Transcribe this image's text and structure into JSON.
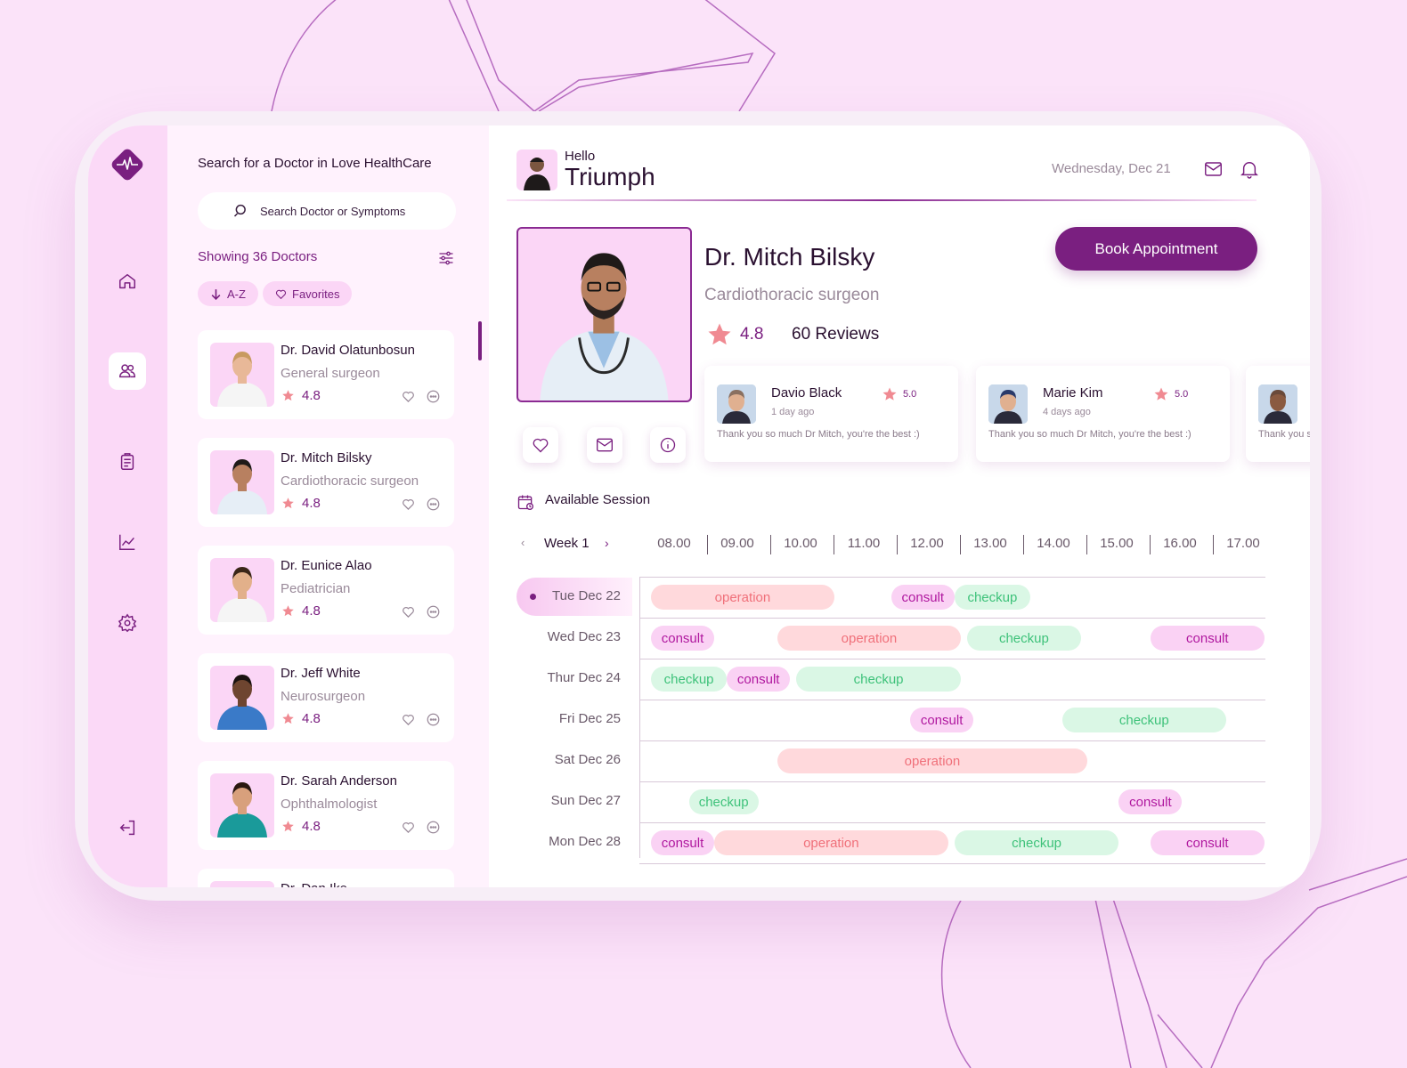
{
  "sidebar": {
    "colors": {
      "accent": "#7a1f80",
      "background": "#fbd9f7"
    },
    "nav_icons": [
      "home-icon",
      "users-icon",
      "clipboard-icon",
      "chart-icon",
      "gear-icon",
      "logout-icon"
    ],
    "active": "users-icon"
  },
  "doctor_list": {
    "title": "Search for a Doctor in Love HealthCare",
    "search_placeholder": "Search Doctor or Symptoms",
    "showing": "Showing 36 Doctors",
    "chips": {
      "sort": "A-Z",
      "favorites": "Favorites"
    },
    "doctors": [
      {
        "name": "Dr. David Olatunbosun",
        "specialty": "General surgeon",
        "rating": "4.8"
      },
      {
        "name": "Dr. Mitch Bilsky",
        "specialty": "Cardiothoracic surgeon",
        "rating": "4.8"
      },
      {
        "name": "Dr. Eunice Alao",
        "specialty": "Pediatrician",
        "rating": "4.8"
      },
      {
        "name": "Dr. Jeff White",
        "specialty": "Neurosurgeon",
        "rating": "4.8"
      },
      {
        "name": "Dr. Sarah Anderson",
        "specialty": "Ophthalmologist",
        "rating": "4.8"
      },
      {
        "name": "Dr. Dan Ike",
        "specialty": "",
        "rating": ""
      }
    ]
  },
  "header": {
    "greeting": "Hello",
    "user": "Triumph",
    "date": "Wednesday, Dec 21"
  },
  "profile": {
    "name": "Dr. Mitch Bilsky",
    "specialty": "Cardiothoracic surgeon",
    "rating": "4.8",
    "reviews": "60 Reviews",
    "book_label": "Book Appointment"
  },
  "reviews": [
    {
      "name": "Davio Black",
      "time": "1 day ago",
      "rating": "5.0",
      "text": "Thank you so much Dr Mitch, you're the best :)"
    },
    {
      "name": "Marie Kim",
      "time": "4 days ago",
      "rating": "5.0",
      "text": "Thank you so much Dr Mitch, you're the best :)"
    },
    {
      "name": "",
      "time": "",
      "rating": "",
      "text": "Thank you so much Dr Mitch, you're the best :)"
    }
  ],
  "sessions": {
    "title": "Available Session",
    "week": "Week 1",
    "hours": [
      "08.00",
      "09.00",
      "10.00",
      "11.00",
      "12.00",
      "13.00",
      "14.00",
      "15.00",
      "16.00",
      "17.00"
    ],
    "days": [
      "Tue Dec 22",
      "Wed Dec 23",
      "Thur Dec 24",
      "Fri Dec 25",
      "Sat Dec 26",
      "Sun Dec 27",
      "Mon Dec 28"
    ],
    "active_day": "Tue Dec 22",
    "colors": {
      "operation": "#f0707a",
      "consult": "#b0189f",
      "checkup": "#3ec27a"
    },
    "events": [
      [
        {
          "type": "operation",
          "start": 8.0,
          "end": 10.9
        },
        {
          "type": "consult",
          "start": 11.8,
          "end": 12.8
        },
        {
          "type": "checkup",
          "start": 12.8,
          "end": 14.0
        }
      ],
      [
        {
          "type": "consult",
          "start": 8.0,
          "end": 9.0
        },
        {
          "type": "operation",
          "start": 10.0,
          "end": 12.9
        },
        {
          "type": "checkup",
          "start": 13.0,
          "end": 14.8
        },
        {
          "type": "consult",
          "start": 15.9,
          "end": 17.7
        }
      ],
      [
        {
          "type": "checkup",
          "start": 8.0,
          "end": 9.2
        },
        {
          "type": "consult",
          "start": 9.2,
          "end": 10.2
        },
        {
          "type": "checkup",
          "start": 10.3,
          "end": 12.9
        }
      ],
      [
        {
          "type": "consult",
          "start": 12.1,
          "end": 13.1
        },
        {
          "type": "checkup",
          "start": 14.5,
          "end": 17.1
        }
      ],
      [
        {
          "type": "operation",
          "start": 10.0,
          "end": 14.9
        }
      ],
      [
        {
          "type": "checkup",
          "start": 8.6,
          "end": 9.7
        },
        {
          "type": "consult",
          "start": 15.4,
          "end": 16.4
        }
      ],
      [
        {
          "type": "consult",
          "start": 8.0,
          "end": 9.0
        },
        {
          "type": "operation",
          "start": 9.0,
          "end": 12.7
        },
        {
          "type": "checkup",
          "start": 12.8,
          "end": 15.4
        },
        {
          "type": "consult",
          "start": 15.9,
          "end": 17.7
        }
      ]
    ]
  }
}
